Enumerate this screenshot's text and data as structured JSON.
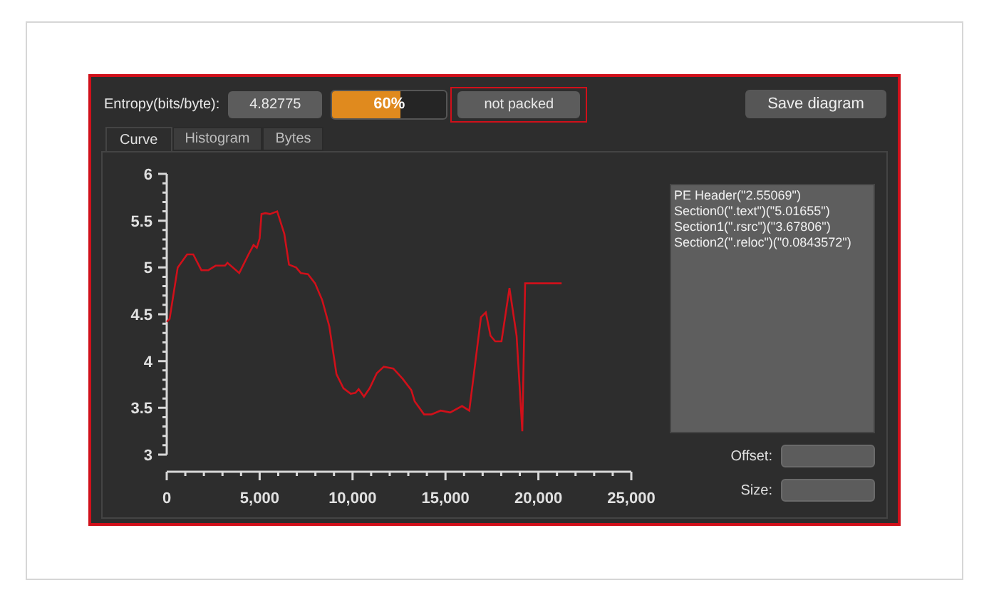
{
  "toolbar": {
    "entropy_label": "Entropy(bits/byte):",
    "entropy_value": "4.82775",
    "progress": {
      "level": 0.6,
      "text": "60%"
    },
    "status": {
      "text": "not packed",
      "highlighted": true
    },
    "save_button": "Save diagram"
  },
  "tabs": [
    {
      "label": "Curve",
      "selected": true
    },
    {
      "label": "Histogram",
      "selected": false
    },
    {
      "label": "Bytes",
      "selected": false
    }
  ],
  "chart_data": {
    "type": "line",
    "xlim": [
      0,
      25000
    ],
    "ylim": [
      3,
      6
    ],
    "xticks": [
      {
        "value": 0,
        "label": "0"
      },
      {
        "value": 5000,
        "label": "5,000"
      },
      {
        "value": 10000,
        "label": "10,000"
      },
      {
        "value": 15000,
        "label": "15,000"
      },
      {
        "value": 20000,
        "label": "20,000"
      },
      {
        "value": 25000,
        "label": "25,000"
      }
    ],
    "yticks": [
      {
        "value": 3,
        "label": "3"
      },
      {
        "value": 3.5,
        "label": "3.5"
      },
      {
        "value": 4,
        "label": "4"
      },
      {
        "value": 4.5,
        "label": "4.5"
      },
      {
        "value": 5,
        "label": "5"
      },
      {
        "value": 5.5,
        "label": "5.5"
      },
      {
        "value": 6,
        "label": "6"
      }
    ],
    "x": [
      0,
      150,
      590,
      1100,
      1430,
      1860,
      2240,
      2630,
      3140,
      3270,
      3900,
      4400,
      4670,
      4850,
      5000,
      5100,
      5310,
      5560,
      5940,
      6330,
      6580,
      6960,
      7220,
      7600,
      7980,
      8370,
      8750,
      9130,
      9510,
      9900,
      10150,
      10330,
      10610,
      10920,
      11300,
      11680,
      12190,
      12700,
      13160,
      13340,
      13850,
      14230,
      14740,
      15250,
      15890,
      16280,
      16530,
      16910,
      17170,
      17420,
      17680,
      18010,
      18440,
      18830,
      19130,
      19290,
      21250
    ],
    "series": [
      {
        "color": "#d0101a",
        "values": [
          4.42,
          4.45,
          5.0,
          5.14,
          5.14,
          4.97,
          4.97,
          5.02,
          5.02,
          5.05,
          4.94,
          5.14,
          5.24,
          5.21,
          5.31,
          5.57,
          5.58,
          5.57,
          5.6,
          5.36,
          5.03,
          5.0,
          4.94,
          4.93,
          4.83,
          4.65,
          4.37,
          3.86,
          3.71,
          3.65,
          3.66,
          3.7,
          3.62,
          3.71,
          3.87,
          3.94,
          3.92,
          3.81,
          3.69,
          3.57,
          3.43,
          3.43,
          3.47,
          3.45,
          3.52,
          3.47,
          3.87,
          4.47,
          4.52,
          4.27,
          4.21,
          4.21,
          4.78,
          4.27,
          3.25,
          4.83,
          4.83
        ]
      }
    ]
  },
  "sections": [
    "PE Header(\"2.55069\")",
    "Section0(\".text\")(\"5.01655\")",
    "Section1(\".rsrc\")(\"3.67806\")",
    "Section2(\".reloc\")(\"0.0843572\")"
  ],
  "fields": [
    {
      "label": "Offset:"
    },
    {
      "label": "Size:"
    }
  ]
}
